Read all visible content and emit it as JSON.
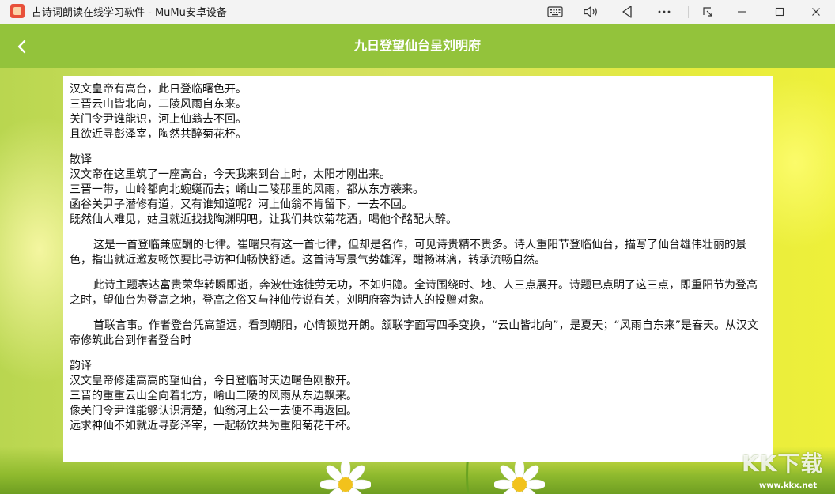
{
  "window": {
    "title": "古诗词朗读在线学习软件 - MuMu安卓设备",
    "controls": [
      "keyboard-icon",
      "volume-icon",
      "back-triangle-icon",
      "more-icon",
      "screenshot-icon",
      "minimize-icon",
      "maximize-icon",
      "close-icon"
    ]
  },
  "header": {
    "title": "九日登望仙台呈刘明府",
    "back_icon": "chevron-left-icon",
    "color": "#93c33b"
  },
  "poem": {
    "lines": [
      "汉文皇帝有高台，此日登临曙色开。",
      "三晋云山皆北向，二陵风雨自东来。",
      "关门令尹谁能识，河上仙翁去不回。",
      "且欲近寻彭泽宰，陶然共醉菊花杯。"
    ]
  },
  "prose_translation": {
    "heading": "散译",
    "lines": [
      "汉文帝在这里筑了一座高台，今天我来到台上时，太阳才刚出来。",
      "三晋一带，山岭都向北蜿蜒而去；崤山二陵那里的风雨，都从东方袭来。",
      "函谷关尹子潜修有道，又有谁知道呢？河上仙翁不肯留下，一去不回。",
      "既然仙人难见，姑且就近找找陶渊明吧，让我们共饮菊花酒，喝他个酩配大醉。"
    ]
  },
  "commentary": [
    "这是一首登临兼应酬的七律。崔曙只有这一首七律，但却是名作，可见诗贵精不贵多。诗人重阳节登临仙台，描写了仙台雄伟壮丽的景色，指出就近邀友畅饮要比寻访神仙畅快舒适。这首诗写景气势雄浑，酣畅淋漓，转承流畅自然。",
    "此诗主题表达富贵荣华转瞬即逝，奔波仕途徒劳无功，不如归隐。全诗围绕时、地、人三点展开。诗题已点明了这三点，即重阳节为登高之时，望仙台为登高之地，登高之俗又与神仙传说有关，刘明府容为诗人的投赠对象。",
    "首联言事。作者登台凭高望远，看到朝阳，心情顿觉开朗。颔联字面写四季变换，“云山皆北向”，是夏天；“风雨自东来”是春天。从汉文帝修筑此台到作者登台时"
  ],
  "verse_translation": {
    "heading": "韵译",
    "lines": [
      "汉文皇帝修建高高的望仙台，今日登临时天边曙色刚散开。",
      "三晋的重重云山全向着北方，崤山二陵的风雨从东边飘来。",
      "像关门令尹谁能够认识清楚，仙翁河上公一去便不再返回。",
      "远求神仙不如就近寻彭泽宰，一起畅饮共为重阳菊花干杯。"
    ]
  },
  "watermark": {
    "logo": "KK下载",
    "url": "www.kkx.net"
  }
}
